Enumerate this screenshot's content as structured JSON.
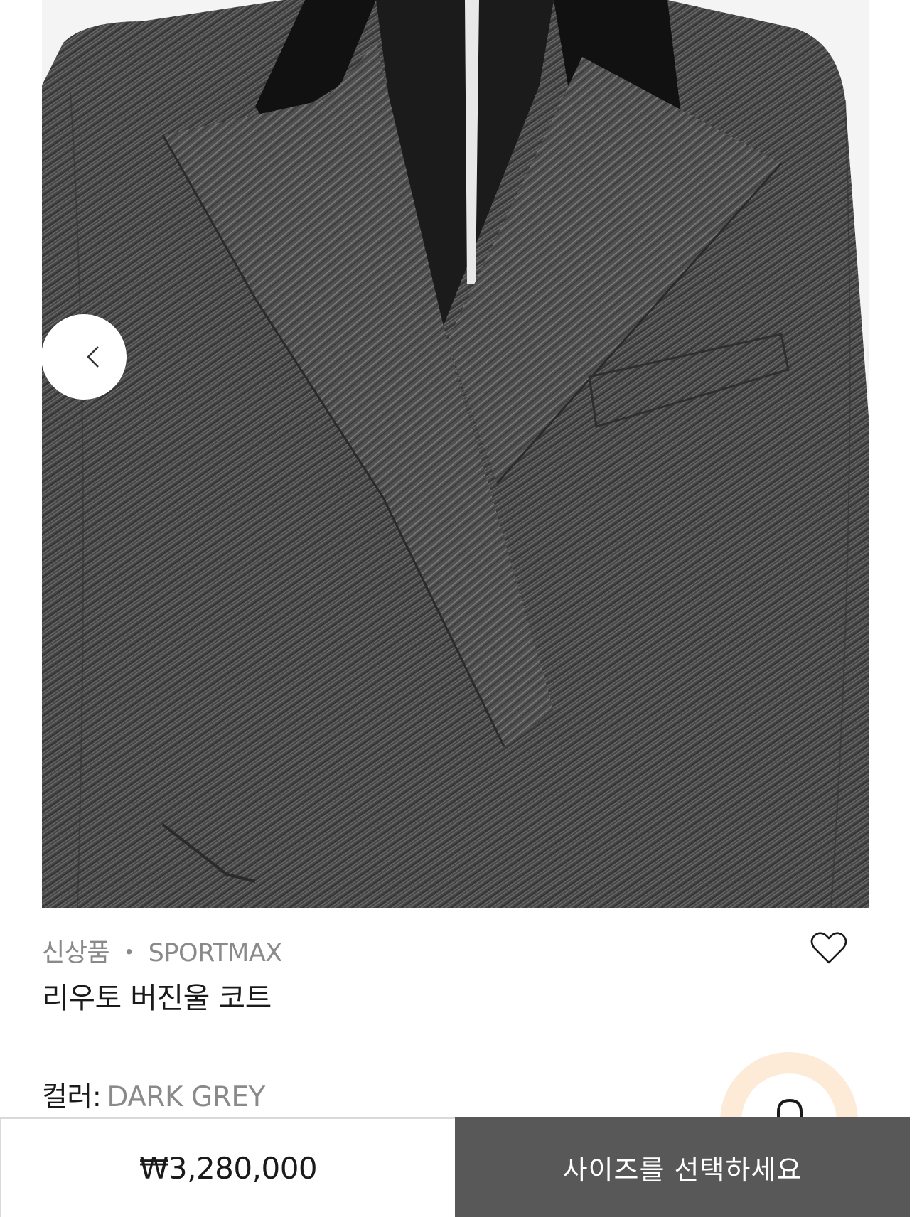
{
  "product": {
    "badge": "신상품",
    "separator": "・",
    "brand": "SPORTMAX",
    "name": "리우토 버진울 코트",
    "color_label": "컬러:",
    "color_value": "DARK GREY",
    "price": "₩3,280,000"
  },
  "actions": {
    "select_size": "사이즈를 선택하세요"
  },
  "icons": {
    "prev": "chevron-left-icon",
    "next": "chevron-right-icon",
    "wishlist": "heart-outline-icon",
    "chat": "chat-bubble-icon"
  },
  "colors": {
    "cta_background": "#585858",
    "chat_badge_ring": "#fdebd8",
    "muted_text": "#8a8a8a"
  }
}
